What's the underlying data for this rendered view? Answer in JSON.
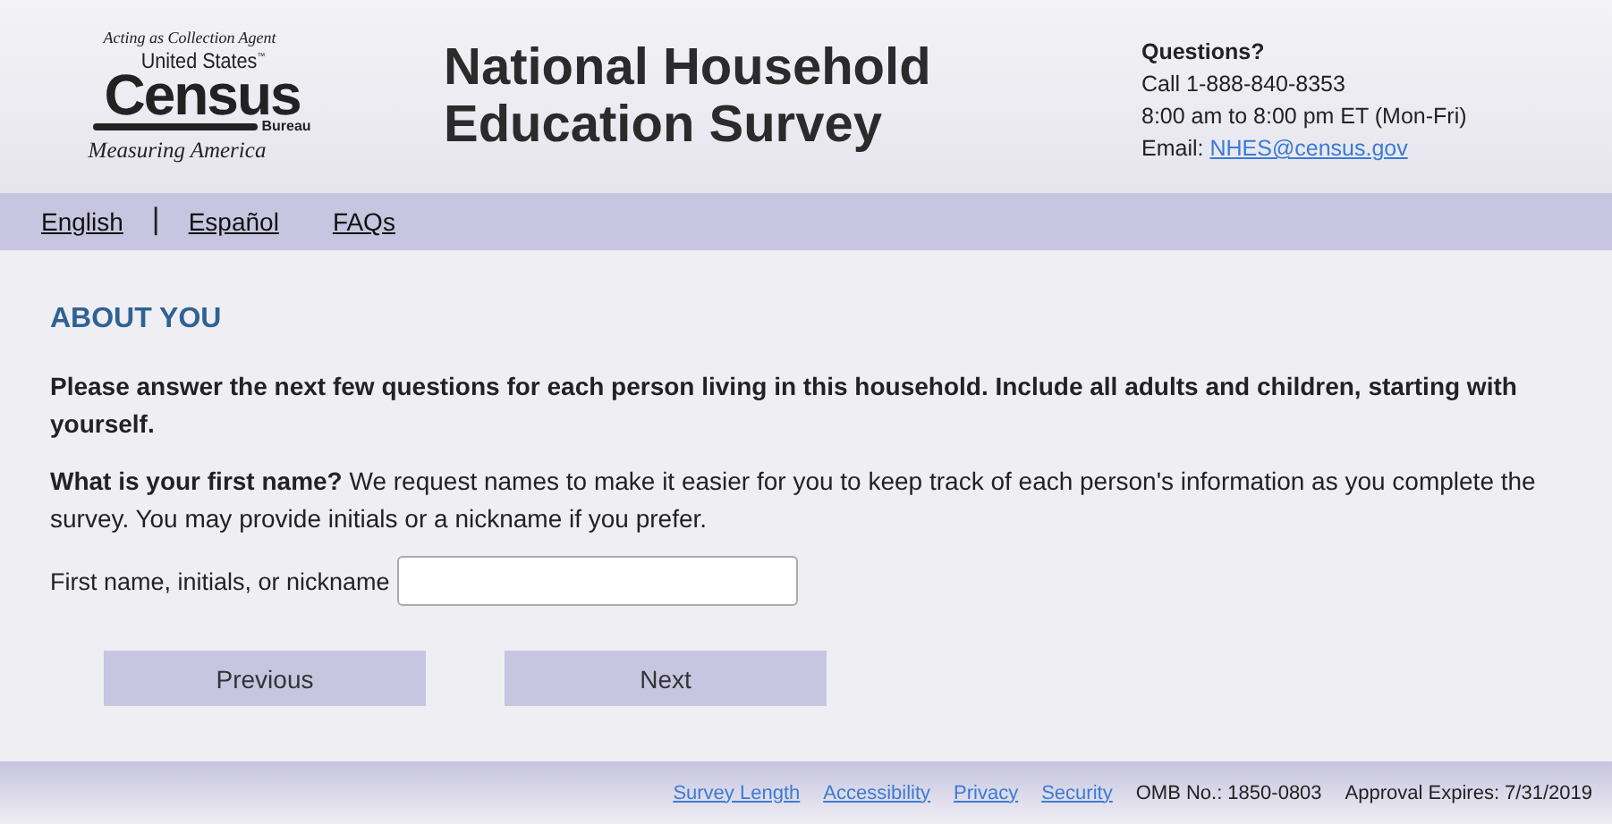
{
  "logo": {
    "tagline": "Acting as Collection Agent",
    "line1": "United States",
    "tm": "™",
    "word": "Census",
    "bureau": "Bureau",
    "motto": "Measuring America"
  },
  "title": [
    "National Household",
    "Education Survey"
  ],
  "contact": {
    "heading": "Questions?",
    "phone": "Call 1-888-840-8353",
    "hours": "8:00 am to 8:00 pm ET (Mon-Fri)",
    "email_label": "Email:",
    "email": "NHES@census.gov"
  },
  "nav": [
    {
      "kind": "link",
      "label": "English"
    },
    {
      "kind": "separator",
      "label": "|"
    },
    {
      "kind": "link",
      "label": "Español"
    },
    {
      "kind": "link",
      "label": "FAQs"
    }
  ],
  "section_title": "ABOUT YOU",
  "intro": "Please answer the next few questions for each person living in this household. Include all adults and children, starting with yourself.",
  "question": "**What is your first name?** We request names to make it easier for you to keep track of each person's information as you complete the survey. You may provide initials or a nickname if you prefer.",
  "field": {
    "label": "First name, initials, or nickname"
  },
  "buttons": [
    "Previous",
    "Next"
  ],
  "footer": {
    "links": [
      "Survey Length",
      "Accessibility",
      "Privacy",
      "Security"
    ],
    "omb": "OMB No.: 1850-0803",
    "expires": "Approval Expires: 7/31/2019"
  }
}
